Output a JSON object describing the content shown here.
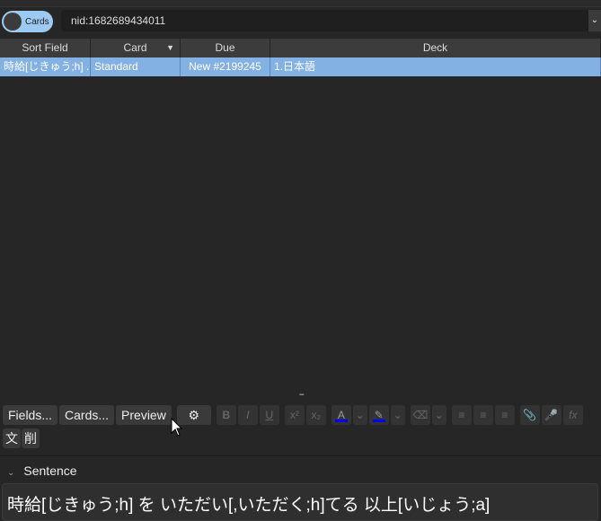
{
  "toggle": {
    "label": "Cards"
  },
  "search": {
    "value": "nid:1682689434011"
  },
  "table": {
    "columns": [
      "Sort Field",
      "Card",
      "Due",
      "Deck"
    ],
    "rows": [
      [
        "時給[じきゅう;h] ...",
        "Standard",
        "New #2199245",
        "1.日本語"
      ]
    ]
  },
  "toolbar": {
    "fields": "Fields...",
    "cards": "Cards...",
    "preview": "Preview",
    "colors": {
      "text": "#0000ff",
      "highlight": "#0000ff"
    }
  },
  "extra_buttons": [
    "文",
    "削"
  ],
  "field": {
    "label": "Sentence",
    "value": "時給[じきゅう;h] を いただい[,いただく;h]てる 以上[いじょう;a]"
  }
}
